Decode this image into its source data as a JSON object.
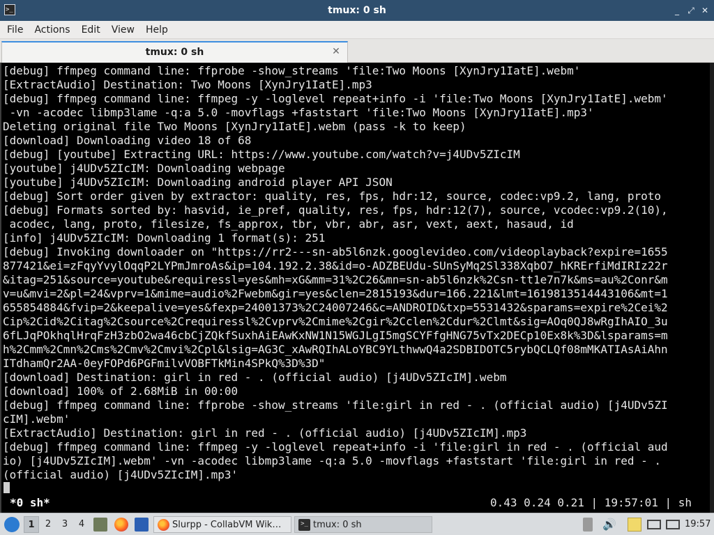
{
  "window": {
    "title": "tmux: 0 sh",
    "buttons": {
      "minimize": "_",
      "maximize": "⤢",
      "close": "✕"
    }
  },
  "menu": [
    "File",
    "Actions",
    "Edit",
    "View",
    "Help"
  ],
  "tab": {
    "label": "tmux: 0 sh",
    "close": "✕"
  },
  "terminal": {
    "lines": [
      "[debug] ffmpeg command line: ffprobe -show_streams 'file:Two Moons [XynJry1IatE].webm'",
      "[ExtractAudio] Destination: Two Moons [XynJry1IatE].mp3",
      "[debug] ffmpeg command line: ffmpeg -y -loglevel repeat+info -i 'file:Two Moons [XynJry1IatE].webm'",
      " -vn -acodec libmp3lame -q:a 5.0 -movflags +faststart 'file:Two Moons [XynJry1IatE].mp3'",
      "Deleting original file Two Moons [XynJry1IatE].webm (pass -k to keep)",
      "[download] Downloading video 18 of 68",
      "[debug] [youtube] Extracting URL: https://www.youtube.com/watch?v=j4UDv5ZIcIM",
      "[youtube] j4UDv5ZIcIM: Downloading webpage",
      "[youtube] j4UDv5ZIcIM: Downloading android player API JSON",
      "[debug] Sort order given by extractor: quality, res, fps, hdr:12, source, codec:vp9.2, lang, proto",
      "[debug] Formats sorted by: hasvid, ie_pref, quality, res, fps, hdr:12(7), source, vcodec:vp9.2(10),",
      " acodec, lang, proto, filesize, fs_approx, tbr, vbr, abr, asr, vext, aext, hasaud, id",
      "[info] j4UDv5ZIcIM: Downloading 1 format(s): 251",
      "[debug] Invoking downloader on \"https://rr2---sn-ab5l6nzk.googlevideo.com/videoplayback?expire=1655",
      "877421&ei=zFqyYvylOqqP2LYPmJmroAs&ip=104.192.2.38&id=o-ADZBEUdu-SUnSyMq2Sl338XqbO7_hKRErfiMdIRIz22r",
      "&itag=251&source=youtube&requiressl=yes&mh=xG&mm=31%2C26&mn=sn-ab5l6nzk%2Csn-tt1e7n7k&ms=au%2Conr&m",
      "v=u&mvi=2&pl=24&vprv=1&mime=audio%2Fwebm&gir=yes&clen=2815193&dur=166.221&lmt=1619813514443106&mt=1",
      "655854884&fvip=2&keepalive=yes&fexp=24001373%2C24007246&c=ANDROID&txp=5531432&sparams=expire%2Cei%2",
      "Cip%2Cid%2Citag%2Csource%2Crequiressl%2Cvprv%2Cmime%2Cgir%2Cclen%2Cdur%2Clmt&sig=AOq0QJ8wRgIhAIO_3u",
      "6fLJqPOkhqlHrqFzH3zbO2wa46cbCjZQkfSuxhAiEAwKxNW1N15WGJLgI5mgSCYFfgHNG75vTx2DECp10Ex8k%3D&lsparams=m",
      "h%2Cmm%2Cmn%2Cms%2Cmv%2Cmvi%2Cpl&lsig=AG3C_xAwRQIhALoYBC9YLthwwQ4a2SDBIDOTC5rybQCLQf08mMKATIAsAiAhn",
      "ITdhamQr2AA-0eyFOPd6PGFmilvVOBFTkMin4SPkQ%3D%3D\"",
      "[download] Destination: girl in red - . (official audio) [j4UDv5ZIcIM].webm",
      "[download] 100% of 2.68MiB in 00:00",
      "[debug] ffmpeg command line: ffprobe -show_streams 'file:girl in red - . (official audio) [j4UDv5ZI",
      "cIM].webm'",
      "[ExtractAudio] Destination: girl in red - . (official audio) [j4UDv5ZIcIM].mp3",
      "[debug] ffmpeg command line: ffmpeg -y -loglevel repeat+info -i 'file:girl in red - . (official aud",
      "io) [j4UDv5ZIcIM].webm' -vn -acodec libmp3lame -q:a 5.0 -movflags +faststart 'file:girl in red - .",
      "(official audio) [j4UDv5ZIcIM].mp3'"
    ]
  },
  "tmux": {
    "window": "*0 sh*",
    "right": "0.43 0.24 0.21 | 19:57:01 | sh"
  },
  "taskbar": {
    "workspaces": [
      "1",
      "2",
      "3",
      "4"
    ],
    "tasks": [
      {
        "label": "Slurpp - CollabVM Wik…",
        "icon": "firefox-icon"
      },
      {
        "label": "tmux: 0 sh",
        "icon": "terminal-icon"
      }
    ],
    "clock": "19:57"
  }
}
